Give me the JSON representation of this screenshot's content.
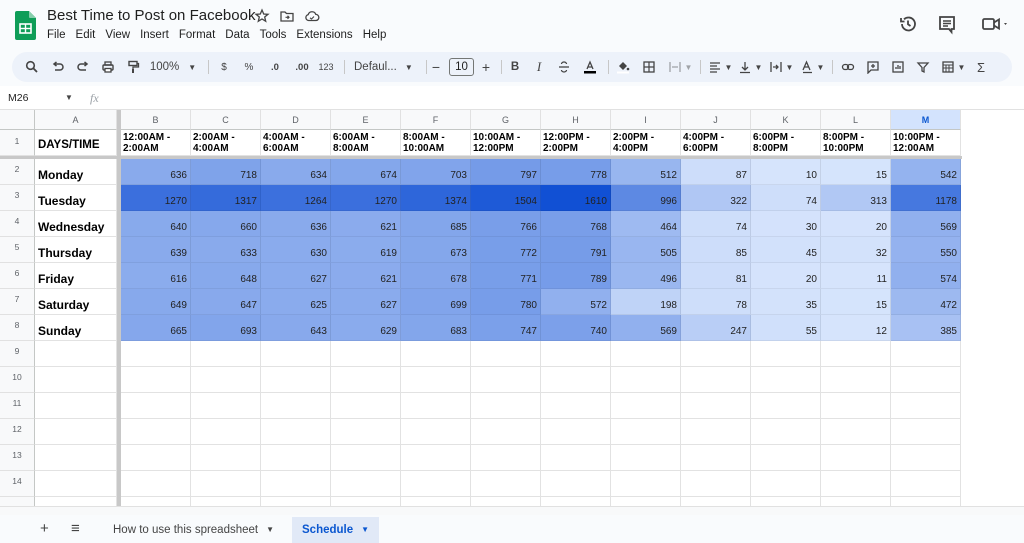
{
  "app": {
    "title": "Best Time to Post on Facebook",
    "menu": [
      "File",
      "Edit",
      "View",
      "Insert",
      "Format",
      "Data",
      "Tools",
      "Extensions",
      "Help"
    ]
  },
  "toolbar": {
    "zoom": "100%",
    "currency": "$",
    "percent": "%",
    "decrease_decimal": ".0",
    "increase_decimal": ".00",
    "number_format": "123",
    "font": "Defaul...",
    "font_size": "10",
    "bold": "B",
    "italic": "I",
    "sum": "Σ"
  },
  "formula_bar": {
    "cell_ref": "M26",
    "fx_label": "fx",
    "value": ""
  },
  "columns": [
    "A",
    "B",
    "C",
    "D",
    "E",
    "F",
    "G",
    "H",
    "I",
    "J",
    "K",
    "L",
    "M"
  ],
  "selected_column": "M",
  "rows_visible": [
    "1",
    "2",
    "3",
    "4",
    "5",
    "6",
    "7",
    "8",
    "9",
    "10",
    "11",
    "12",
    "13",
    "14"
  ],
  "sheet": {
    "header_label": "DAYS/TIME",
    "time_slots": [
      [
        "12:00AM -",
        "2:00AM"
      ],
      [
        "2:00AM -",
        "4:00AM"
      ],
      [
        "4:00AM -",
        "6:00AM"
      ],
      [
        "6:00AM -",
        "8:00AM"
      ],
      [
        "8:00AM -",
        "10:00AM"
      ],
      [
        "10:00AM -",
        "12:00PM"
      ],
      [
        "12:00PM -",
        "2:00PM"
      ],
      [
        "2:00PM -",
        "4:00PM"
      ],
      [
        "4:00PM -",
        "6:00PM"
      ],
      [
        "6:00PM -",
        "8:00PM"
      ],
      [
        "8:00PM -",
        "10:00PM"
      ],
      [
        "10:00PM -",
        "12:00AM"
      ]
    ],
    "days": [
      {
        "day": "Monday",
        "values": [
          636,
          718,
          634,
          674,
          703,
          797,
          778,
          512,
          87,
          10,
          15,
          542
        ]
      },
      {
        "day": "Tuesday",
        "values": [
          1270,
          1317,
          1264,
          1270,
          1374,
          1504,
          1610,
          996,
          322,
          74,
          313,
          1178
        ]
      },
      {
        "day": "Wednesday",
        "values": [
          640,
          660,
          636,
          621,
          685,
          766,
          768,
          464,
          74,
          30,
          20,
          569
        ]
      },
      {
        "day": "Thursday",
        "values": [
          639,
          633,
          630,
          619,
          673,
          772,
          791,
          505,
          85,
          45,
          32,
          550
        ]
      },
      {
        "day": "Friday",
        "values": [
          616,
          648,
          627,
          621,
          678,
          771,
          789,
          496,
          81,
          20,
          11,
          574
        ]
      },
      {
        "day": "Saturday",
        "values": [
          649,
          647,
          625,
          627,
          699,
          780,
          572,
          198,
          78,
          35,
          15,
          472
        ]
      },
      {
        "day": "Sunday",
        "values": [
          665,
          693,
          643,
          629,
          683,
          747,
          740,
          569,
          247,
          55,
          12,
          385
        ]
      }
    ],
    "heatmap_colors": {
      "low": "#d6e4fc",
      "high": "#1150d4"
    }
  },
  "tabs": {
    "add_label": "+",
    "list_label": "≡",
    "items": [
      {
        "label": "How to use this spreadsheet",
        "active": false
      },
      {
        "label": "Schedule",
        "active": true
      }
    ]
  }
}
